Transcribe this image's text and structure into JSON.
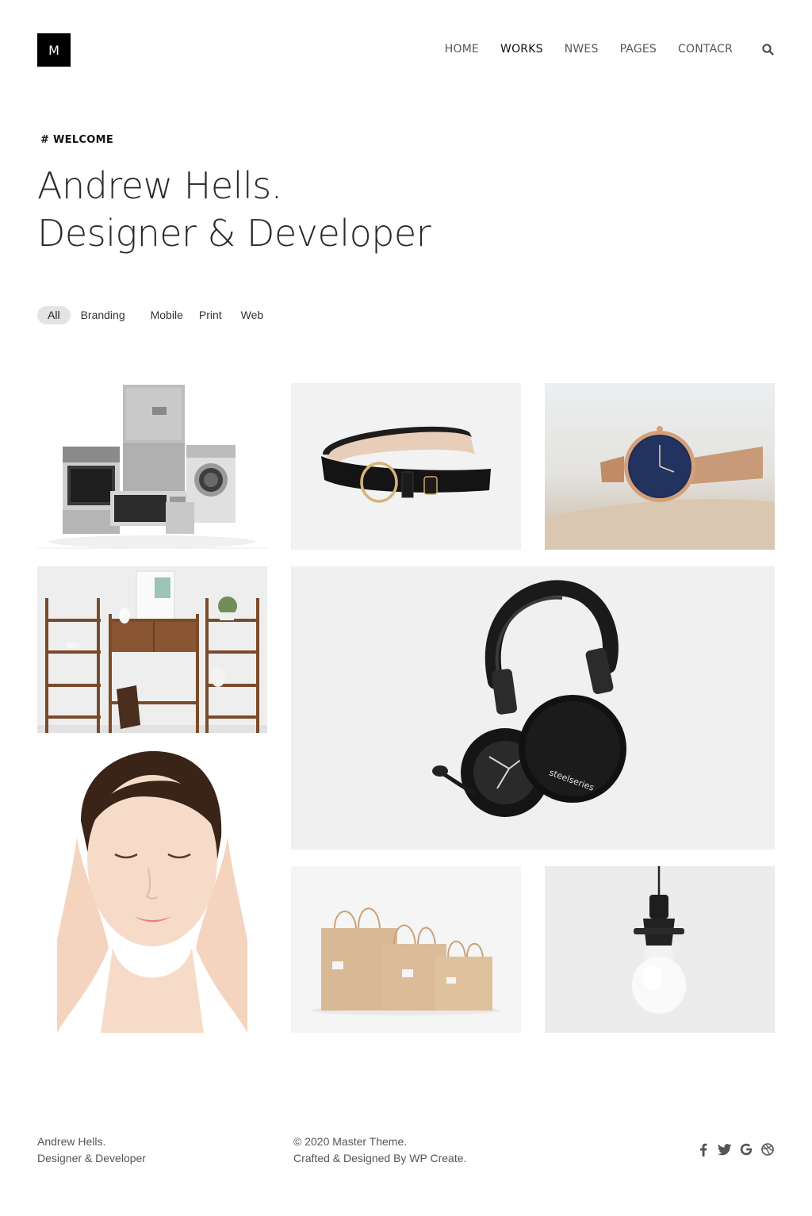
{
  "header": {
    "logo_letter": "M",
    "nav": [
      "HOME",
      "WORKS",
      "NWES",
      "PAGES",
      "CONTACR"
    ],
    "active_nav": "WORKS"
  },
  "hero": {
    "kicker": "# WELCOME",
    "title_line1": "Andrew Hells.",
    "title_line2": "Designer & Developer"
  },
  "filters": [
    "All",
    "Branding",
    "Mobile",
    "Print",
    "Web"
  ],
  "active_filter": "All",
  "portfolio": [
    {
      "icon": "appliances"
    },
    {
      "icon": "belt"
    },
    {
      "icon": "watch"
    },
    {
      "icon": "shelf"
    },
    {
      "icon": "headphones",
      "brand_text": "steelseries"
    },
    {
      "icon": "face"
    },
    {
      "icon": "paper-bags"
    },
    {
      "icon": "light-bulb"
    }
  ],
  "footer": {
    "name": "Andrew Hells.",
    "role": "Designer & Developer",
    "copyright": "© 2020 Master Theme.",
    "credit": "Crafted & Designed By WP Create."
  },
  "social": [
    "facebook-icon",
    "twitter-icon",
    "google-icon",
    "dribbble-icon"
  ]
}
